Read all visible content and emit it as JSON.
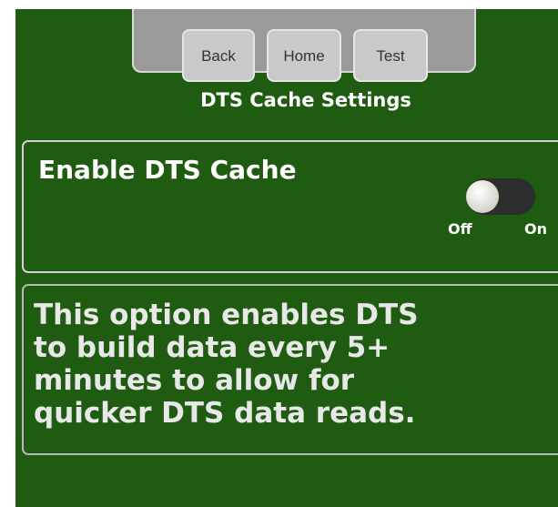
{
  "nav": {
    "back_label": "Back",
    "home_label": "Home",
    "test_label": "Test"
  },
  "page_title": "DTS Cache Settings",
  "setting": {
    "label": "Enable DTS Cache",
    "toggle": {
      "state": "off",
      "off_label": "Off",
      "on_label": "On"
    }
  },
  "description": "This option enables DTS to build data every 5+ minutes to allow for quicker DTS data reads.",
  "colors": {
    "background": "#1f5c12",
    "nav_panel": "#9a9a9a",
    "button": "#c9c9c9",
    "text": "#ffffff"
  }
}
